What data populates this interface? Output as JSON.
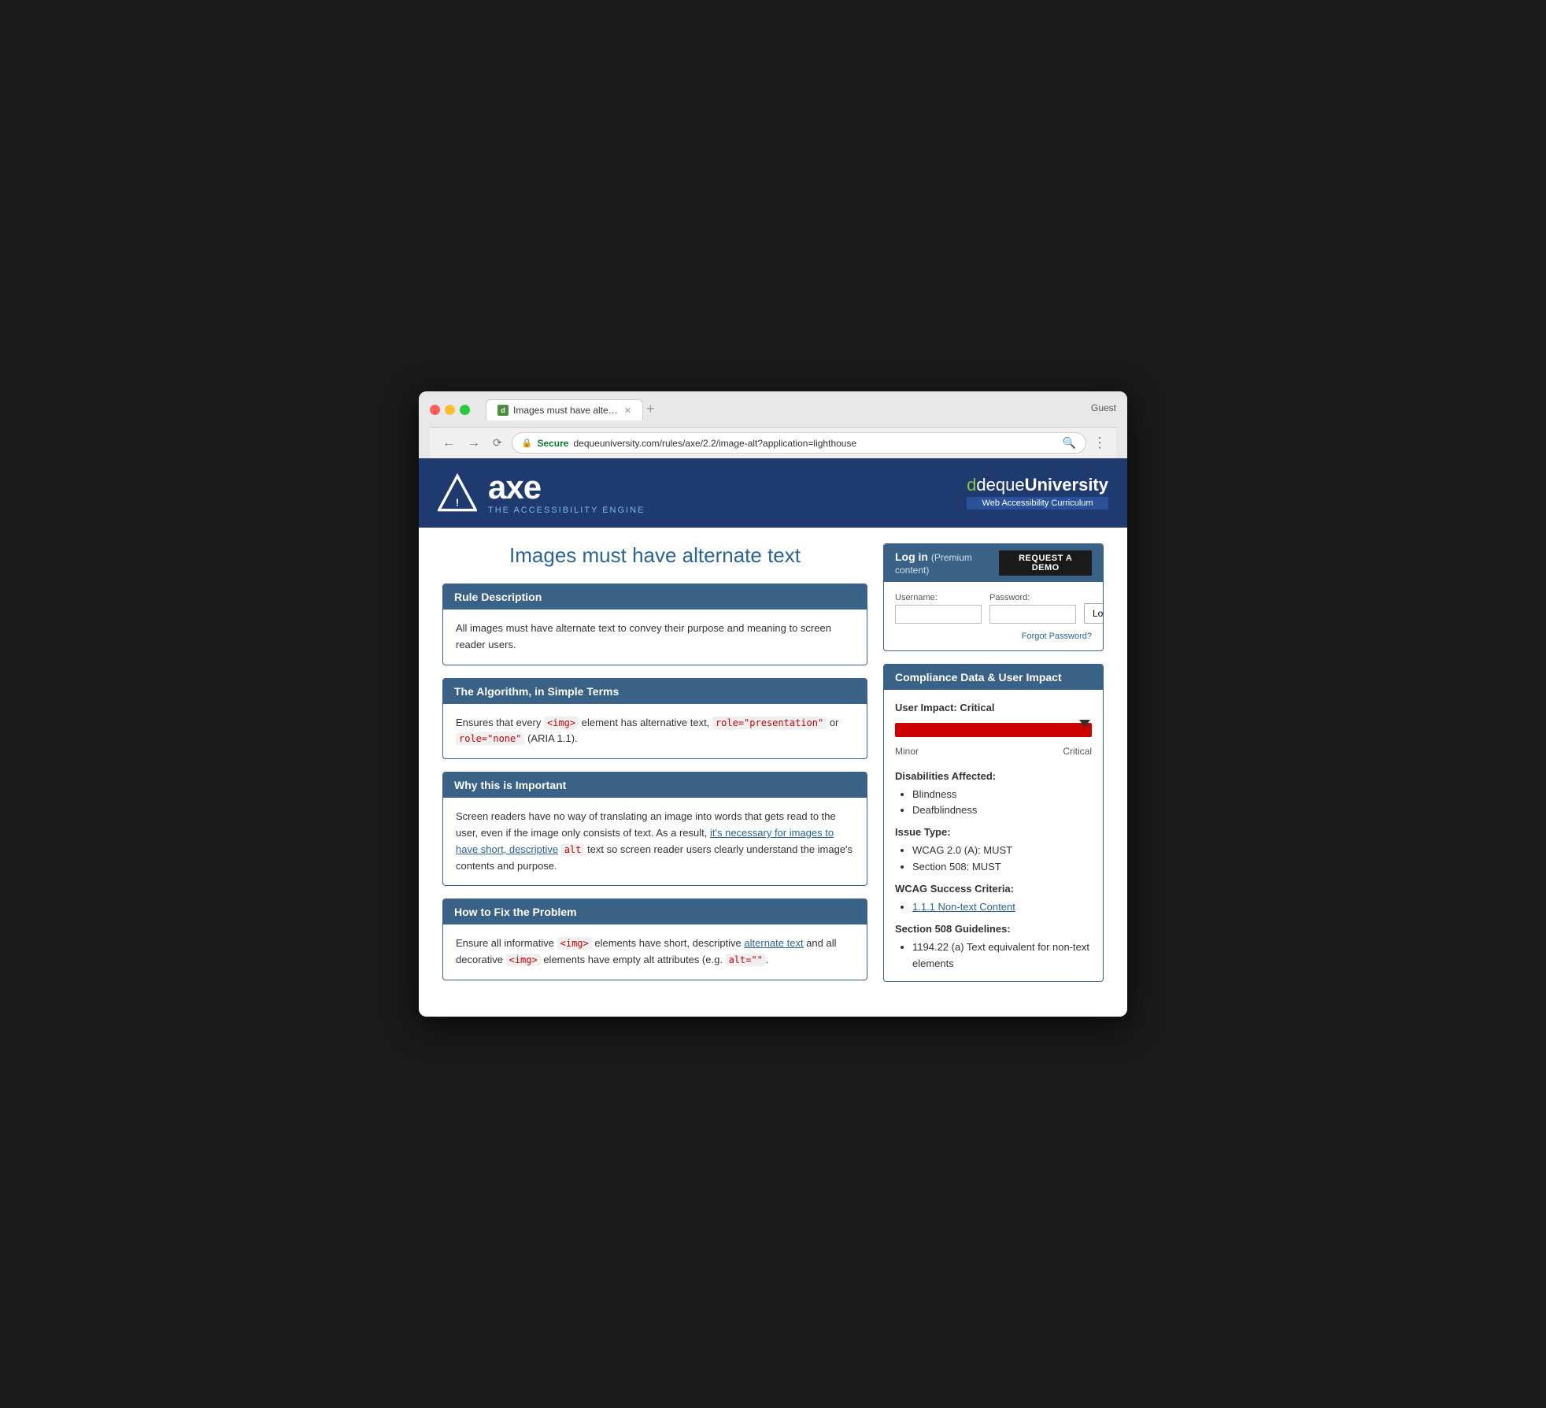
{
  "browser": {
    "guest_label": "Guest",
    "tab_title": "Images must have alternate te…",
    "tab_favicon": "d",
    "url_secure": "Secure",
    "url_full": "https://dequeuniversity.com/rules/axe/2.2/image-alt?application=lighthouse",
    "url_host": "dequeuniversity.com",
    "url_path": "/rules/axe/2.2/image-alt?application=lighthouse"
  },
  "header": {
    "axe_wordmark": "axe",
    "axe_tagline": "THE ACCESSIBILITY ENGINE",
    "deque_logo_prefix": "deque",
    "deque_logo_suffix": "University",
    "deque_subtitle": "Web Accessibility Curriculum"
  },
  "page": {
    "title": "Images must have alternate text"
  },
  "login": {
    "header_label": "Log in",
    "premium_label": "(Premium content)",
    "request_demo_btn": "REQUEST A DEMO",
    "username_label": "Username:",
    "password_label": "Password:",
    "login_btn": "Login",
    "forgot_password": "Forgot Password?"
  },
  "cards": [
    {
      "id": "rule-description",
      "header": "Rule Description",
      "body": "All images must have alternate text to convey their purpose and meaning to screen reader users."
    },
    {
      "id": "algorithm",
      "header": "The Algorithm, in Simple Terms",
      "body_parts": [
        "Ensures that every ",
        "<img>",
        " element has alternative text, ",
        "role=\"presentation\"",
        " or ",
        "role=\"none\"",
        " (ARIA 1.1)."
      ]
    },
    {
      "id": "why-important",
      "header": "Why this is Important",
      "body_part1": "Screen readers have no way of translating an image into words that gets read to the user, even if the image only consists of text. As a result, ",
      "body_link": "it's necessary for images to have short, descriptive",
      "body_code": "alt",
      "body_part2": " text so screen reader users clearly understand the image's contents and purpose."
    },
    {
      "id": "how-to-fix",
      "header": "How to Fix the Problem",
      "body_part1": "Ensure all informative ",
      "code1": "<img>",
      "body_part2": " elements have short, descriptive ",
      "link1": "alternate text",
      "body_part3": " and all decorative ",
      "code2": "<img>",
      "body_part4": " elements have empty alt attributes (e.g. ",
      "code3": "alt=\"\"",
      "body_part5": "."
    }
  ],
  "compliance": {
    "header": "Compliance Data & User Impact",
    "user_impact_label": "User Impact:",
    "user_impact_value": "Critical",
    "slider_min": "Minor",
    "slider_max": "Critical",
    "disabilities_label": "Disabilities Affected:",
    "disabilities": [
      "Blindness",
      "Deafblindness"
    ],
    "issue_type_label": "Issue Type:",
    "issue_types": [
      "WCAG 2.0 (A): MUST",
      "Section 508: MUST"
    ],
    "wcag_label": "WCAG Success Criteria:",
    "wcag_items": [
      "1.1.1 Non-text Content"
    ],
    "section508_label": "Section 508 Guidelines:",
    "section508_items": [
      "1194.22 (a) Text equivalent for non-text elements"
    ]
  }
}
